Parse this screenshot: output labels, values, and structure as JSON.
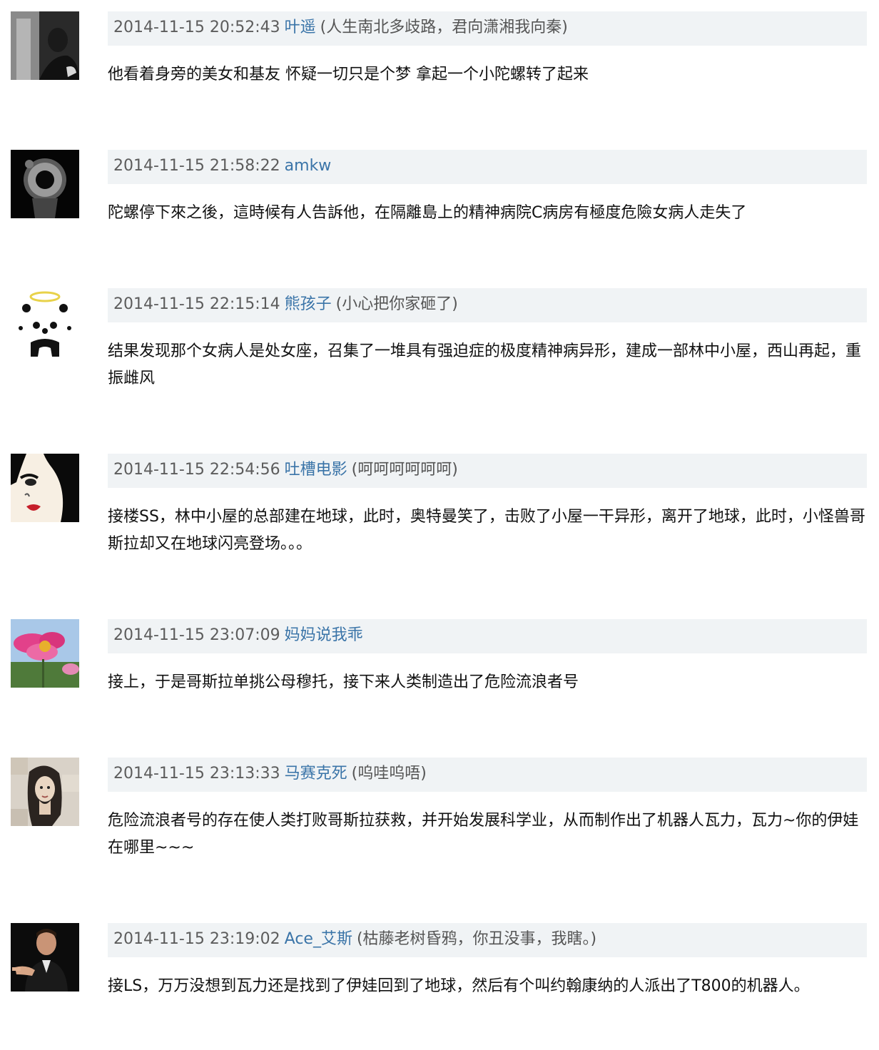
{
  "comments": [
    {
      "time": "2014-11-15 20:52:43",
      "user": "叶遥",
      "signature": "(人生南北多歧路，君向潇湘我向秦)",
      "text": "他看着身旁的美女和基友 怀疑一切只是个梦 拿起一个小陀螺转了起来",
      "avatar_icon": "dark-portrait-avatar"
    },
    {
      "time": "2014-11-15 21:58:22",
      "user": "amkw",
      "signature": "",
      "text": "陀螺停下來之後，這時候有人告訴他，在隔離島上的精神病院C病房有極度危險女病人走失了",
      "avatar_icon": "gun-barrel-avatar"
    },
    {
      "time": "2014-11-15 22:15:14",
      "user": "熊孩子",
      "signature": "(小心把你家砸了)",
      "text": "结果发现那个女病人是处女座，召集了一堆具有强迫症的极度精神病异形，建成一部林中小屋，西山再起，重振雌风",
      "avatar_icon": "panda-angel-avatar"
    },
    {
      "time": "2014-11-15 22:54:56",
      "user": "吐槽电影",
      "signature": "(呵呵呵呵呵呵)",
      "text": "接楼SS，林中小屋的总部建在地球，此时，奥特曼笑了，击败了小屋一干异形，离开了地球，此时，小怪兽哥斯拉却又在地球闪亮登场。。。",
      "avatar_icon": "cartoon-face-avatar"
    },
    {
      "time": "2014-11-15 23:07:09",
      "user": "妈妈说我乖",
      "signature": "",
      "text": "接上，于是哥斯拉单挑公母穆托，接下来人类制造出了危险流浪者号",
      "avatar_icon": "pink-flower-avatar"
    },
    {
      "time": "2014-11-15 23:13:33",
      "user": "马赛克死",
      "signature": "(呜哇呜唔)",
      "text": "危险流浪者号的存在使人类打败哥斯拉获救，并开始发展科学业，从而制作出了机器人瓦力，瓦力~你的伊娃在哪里~~~",
      "avatar_icon": "mosaic-woman-avatar"
    },
    {
      "time": "2014-11-15 23:19:02",
      "user": "Ace_艾斯",
      "signature": "(枯藤老树昏鸦，你丑没事，我瞎。)",
      "text": "接LS，万万没想到瓦力还是找到了伊娃回到了地球，然后有个叫约翰康纳的人派出了T800的机器人。",
      "avatar_icon": "man-pointing-avatar"
    }
  ]
}
